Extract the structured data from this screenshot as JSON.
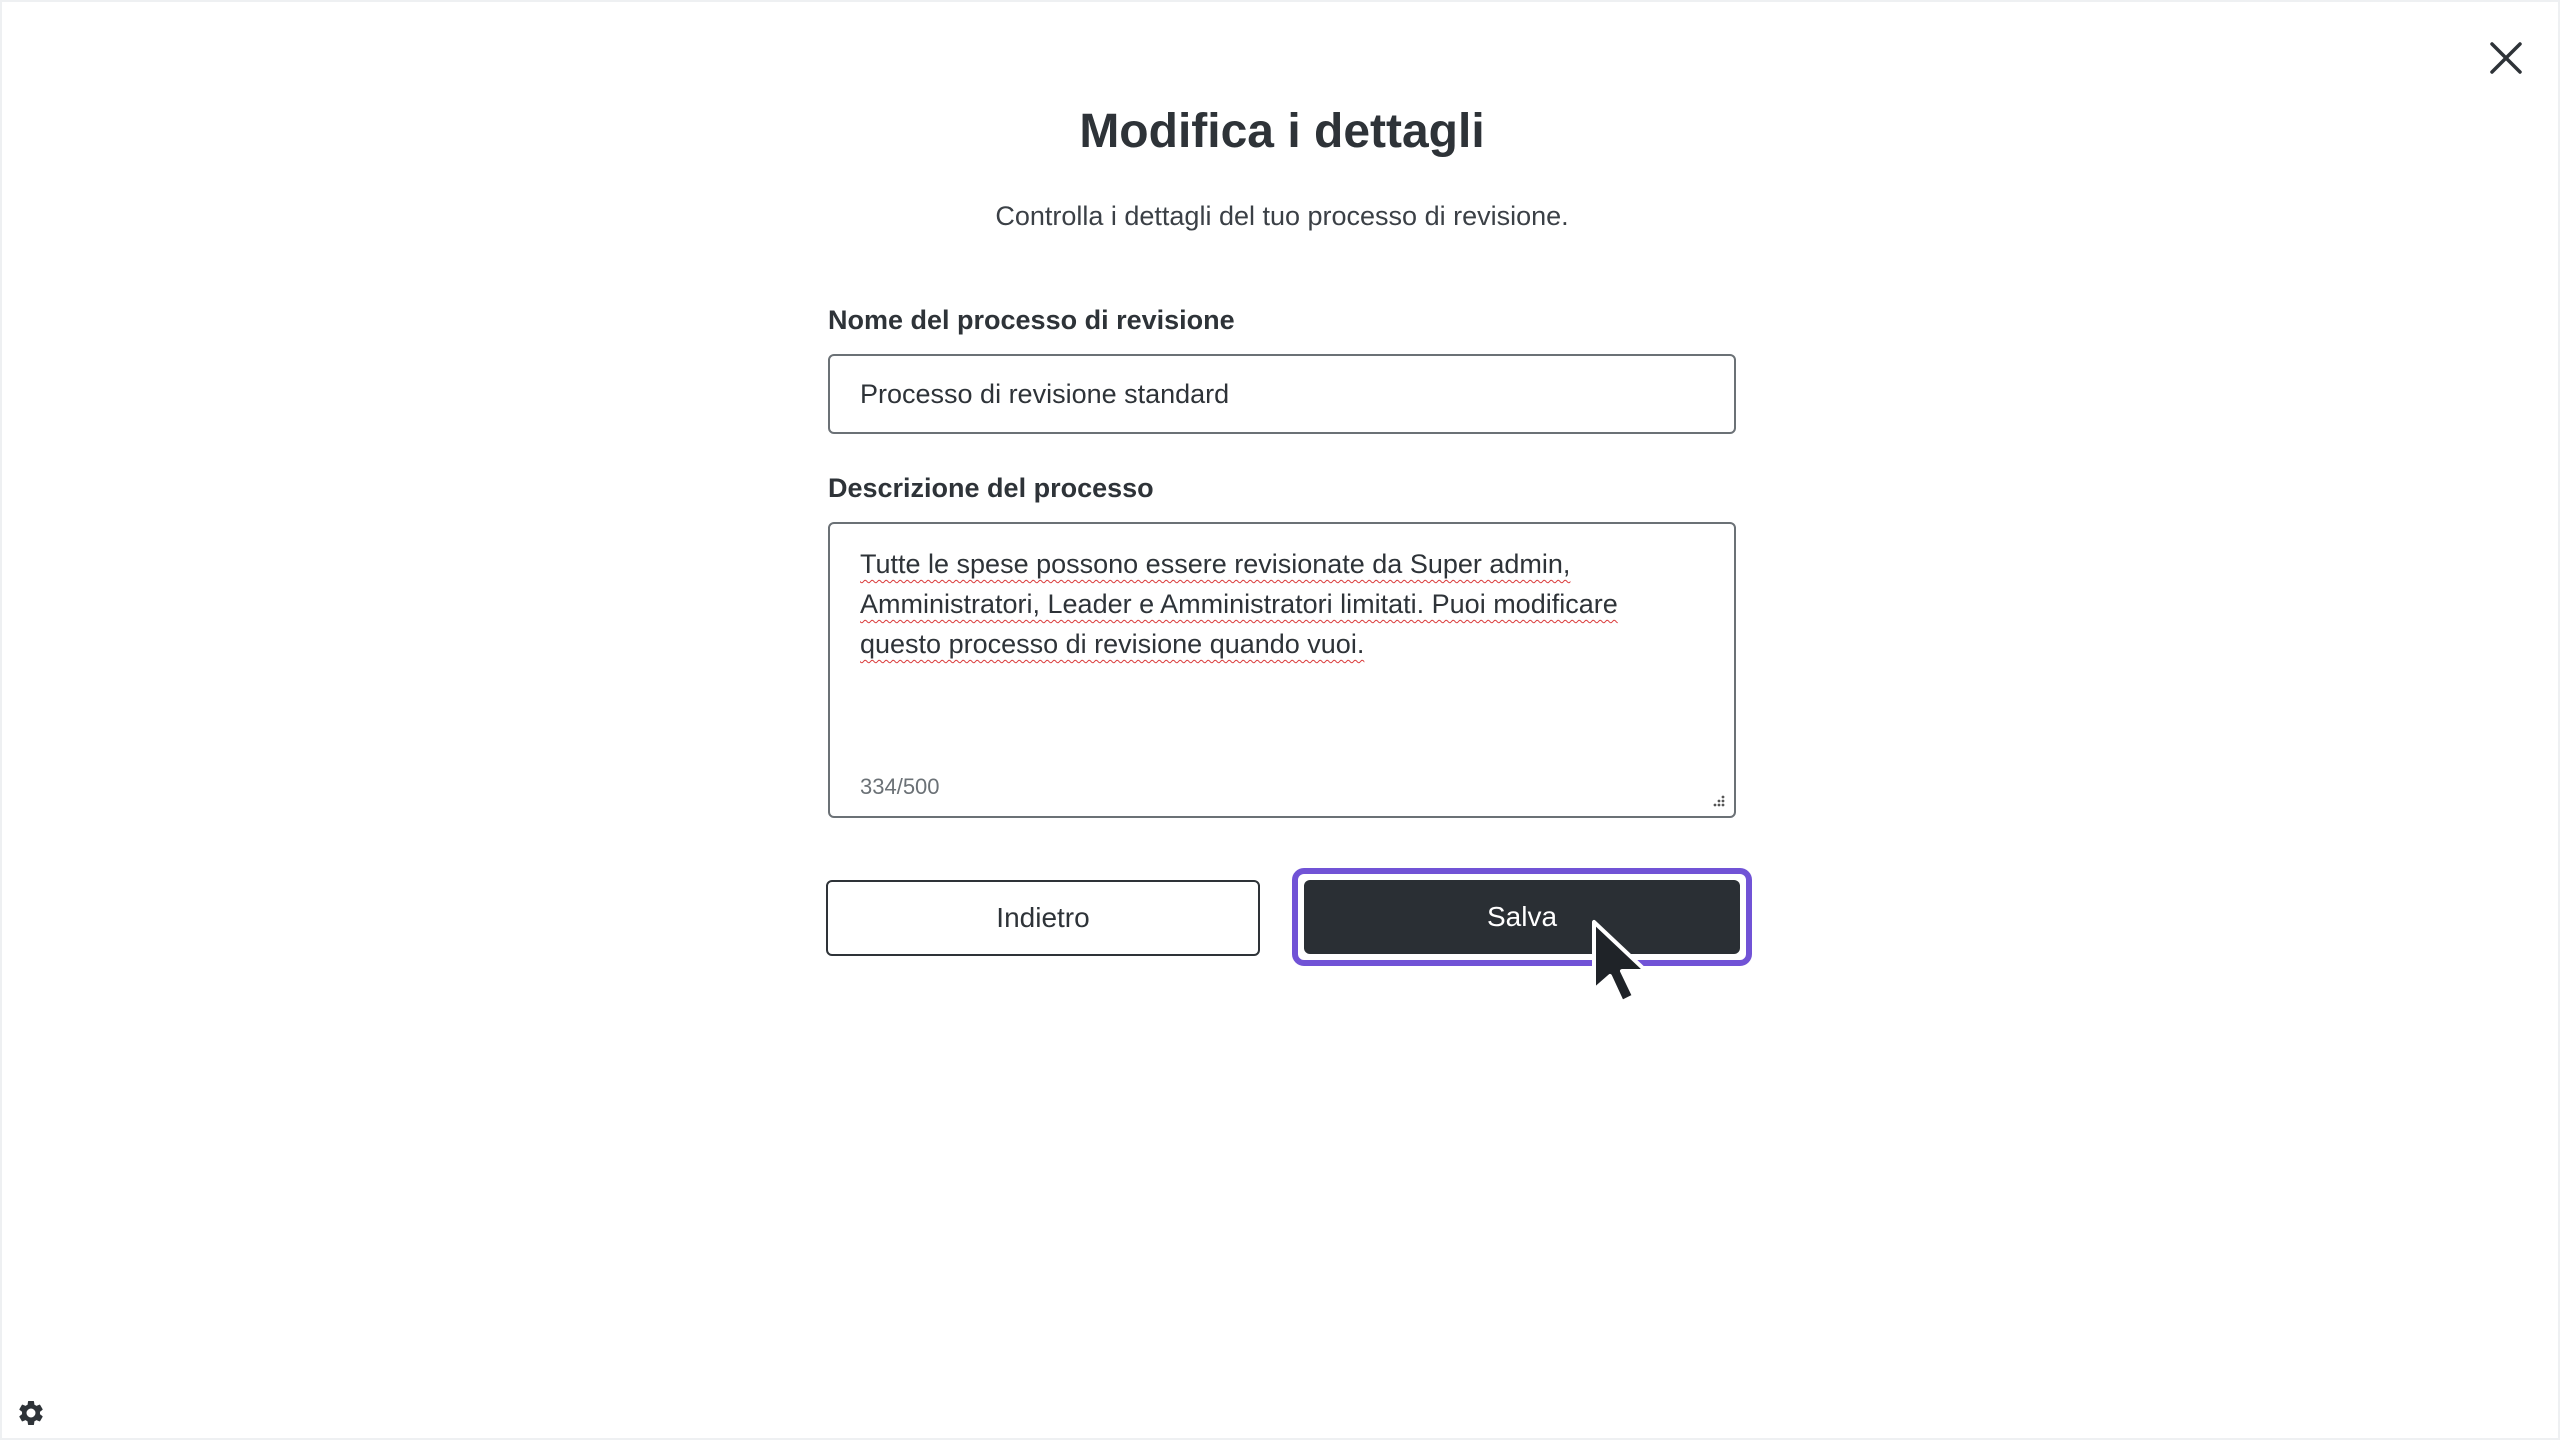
{
  "dialog": {
    "title": "Modifica i dettagli",
    "subtitle": "Controlla i dettagli del tuo processo di revisione."
  },
  "form": {
    "name_label": "Nome del processo di revisione",
    "name_value": "Processo di revisione standard",
    "description_label": "Descrizione del processo",
    "description_value": "Tutte le spese possono essere revisionate da Super admin, Amministratori, Leader e Amministratori limitati. Puoi modificare questo processo di revisione quando vuoi.",
    "char_count": "334/500"
  },
  "actions": {
    "back_label": "Indietro",
    "save_label": "Salva"
  },
  "icons": {
    "close": "close-icon",
    "settings": "gear-icon",
    "resize": "resize-handle-icon",
    "cursor": "mouse-pointer-icon"
  },
  "colors": {
    "primary_button": "#2a2f34",
    "focus_ring": "#7153d6",
    "spellcheck_underline": "#d93838",
    "border": "#6b7176"
  }
}
